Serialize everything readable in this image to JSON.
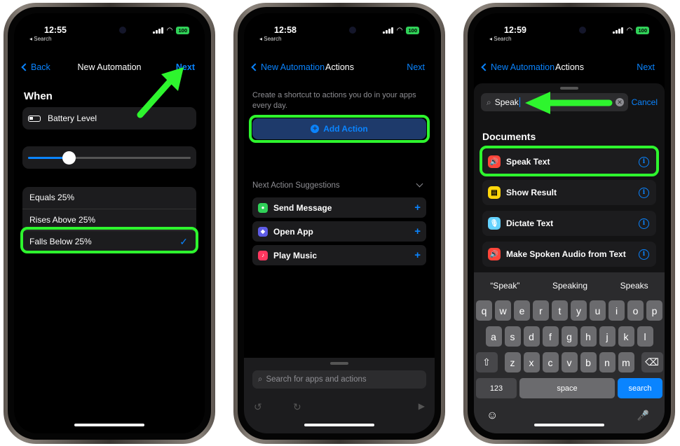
{
  "colors": {
    "accent": "#0a84ff",
    "highlight": "#2ef52e",
    "background": "#000000",
    "card": "#1c1c1e"
  },
  "screen1": {
    "status": {
      "time": "12:55",
      "back": "◂ Search",
      "battery": "100"
    },
    "nav": {
      "back": "Back",
      "title": "New Automation",
      "next": "Next"
    },
    "section": "When",
    "trigger": {
      "icon": "battery-icon",
      "label": "Battery Level"
    },
    "slider": {
      "level": 0.25
    },
    "options": [
      {
        "label": "Equals 25%"
      },
      {
        "label": "Rises Above 25%"
      },
      {
        "label": "Falls Below 25%",
        "selected": true
      }
    ]
  },
  "screen2": {
    "status": {
      "time": "12:58",
      "back": "◂ Search",
      "battery": "100"
    },
    "nav": {
      "back": "New Automation",
      "title": "Actions",
      "next": "Next"
    },
    "description": "Create a shortcut to actions you do in your apps every day.",
    "add_action": "Add Action",
    "suggestions_header": "Next Action Suggestions",
    "suggestions": [
      {
        "label": "Send Message",
        "icon": "messages-icon",
        "color": "#30d158"
      },
      {
        "label": "Open App",
        "icon": "shortcuts-icon",
        "color": "#5e5ce6"
      },
      {
        "label": "Play Music",
        "icon": "music-icon",
        "color": "#ff375f"
      }
    ],
    "search_placeholder": "Search for apps and actions"
  },
  "screen3": {
    "status": {
      "time": "12:59",
      "back": "◂ Search",
      "battery": "100"
    },
    "nav": {
      "back": "New Automation",
      "title": "Actions",
      "next": "Next"
    },
    "search": {
      "value": "Speak",
      "cancel": "Cancel"
    },
    "section": "Documents",
    "actions": [
      {
        "label": "Speak Text",
        "icon": "speaker-icon",
        "color": "#ff453a"
      },
      {
        "label": "Show Result",
        "icon": "result-icon",
        "color": "#ffd60a"
      },
      {
        "label": "Dictate Text",
        "icon": "microphone-icon",
        "color": "#64d2ff"
      },
      {
        "label": "Make Spoken Audio from Text",
        "icon": "speaker-icon",
        "color": "#ff453a"
      }
    ],
    "predictions": [
      "“Speak”",
      "Speaking",
      "Speaks"
    ],
    "keyboard": {
      "row1": [
        "q",
        "w",
        "e",
        "r",
        "t",
        "y",
        "u",
        "i",
        "o",
        "p"
      ],
      "row2": [
        "a",
        "s",
        "d",
        "f",
        "g",
        "h",
        "j",
        "k",
        "l"
      ],
      "row3": [
        "z",
        "x",
        "c",
        "v",
        "b",
        "n",
        "m"
      ],
      "numbers": "123",
      "space": "space",
      "search": "search"
    }
  }
}
